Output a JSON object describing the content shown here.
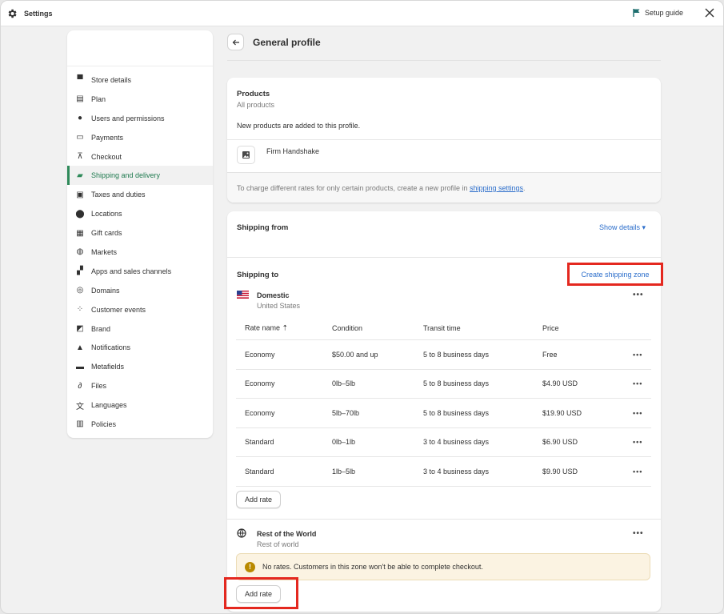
{
  "app": {
    "title": "Settings",
    "setup_guide": "Setup guide"
  },
  "sidebar": {
    "items": [
      {
        "label": "Store details",
        "icon": "store-icon"
      },
      {
        "label": "Plan",
        "icon": "plan-icon"
      },
      {
        "label": "Users and permissions",
        "icon": "user-icon"
      },
      {
        "label": "Payments",
        "icon": "credit-card-icon"
      },
      {
        "label": "Checkout",
        "icon": "cart-icon"
      },
      {
        "label": "Shipping and delivery",
        "icon": "truck-icon",
        "active": true
      },
      {
        "label": "Taxes and duties",
        "icon": "tax-icon"
      },
      {
        "label": "Locations",
        "icon": "location-pin-icon"
      },
      {
        "label": "Gift cards",
        "icon": "gift-icon"
      },
      {
        "label": "Markets",
        "icon": "globe-icon"
      },
      {
        "label": "Apps and sales channels",
        "icon": "apps-icon"
      },
      {
        "label": "Domains",
        "icon": "domain-icon"
      },
      {
        "label": "Customer events",
        "icon": "cursor-icon"
      },
      {
        "label": "Brand",
        "icon": "brand-icon"
      },
      {
        "label": "Notifications",
        "icon": "bell-icon"
      },
      {
        "label": "Metafields",
        "icon": "metafields-icon"
      },
      {
        "label": "Files",
        "icon": "paperclip-icon"
      },
      {
        "label": "Languages",
        "icon": "translate-icon"
      },
      {
        "label": "Policies",
        "icon": "policy-icon"
      }
    ]
  },
  "header": {
    "title": "General profile"
  },
  "products_card": {
    "title": "Products",
    "subtitle": "All products",
    "description": "New products are added to this profile.",
    "product_name": "Firm Handshake",
    "note_prefix": "To charge different rates for only certain products, create a new profile in ",
    "note_link": "shipping settings",
    "note_suffix": "."
  },
  "shipping": {
    "from_title": "Shipping from",
    "show_details": "Show details ▾",
    "to_title": "Shipping to",
    "create_zone": "Create shipping zone",
    "domestic": {
      "name": "Domestic",
      "region": "United States"
    },
    "columns": [
      "Rate name ⇡",
      "Condition",
      "Transit time",
      "Price"
    ],
    "rows": [
      {
        "name": "Economy",
        "condition": "$50.00 and up",
        "transit": "5 to 8 business days",
        "price": "Free"
      },
      {
        "name": "Economy",
        "condition": "0lb–5lb",
        "transit": "5 to 8 business days",
        "price": "$4.90 USD"
      },
      {
        "name": "Economy",
        "condition": "5lb–70lb",
        "transit": "5 to 8 business days",
        "price": "$19.90 USD"
      },
      {
        "name": "Standard",
        "condition": "0lb–1lb",
        "transit": "3 to 4 business days",
        "price": "$6.90 USD"
      },
      {
        "name": "Standard",
        "condition": "1lb–5lb",
        "transit": "3 to 4 business days",
        "price": "$9.90 USD"
      }
    ],
    "add_rate": "Add rate",
    "world": {
      "name": "Rest of the World",
      "region": "Rest of world"
    },
    "warning": "No rates. Customers in this zone won't be able to complete checkout.",
    "add_rate_world": "Add rate",
    "more": "•••"
  },
  "colors": {
    "highlight": "#e4281f",
    "link": "#2c6ecb",
    "active_nav": "#1f7a4f"
  }
}
